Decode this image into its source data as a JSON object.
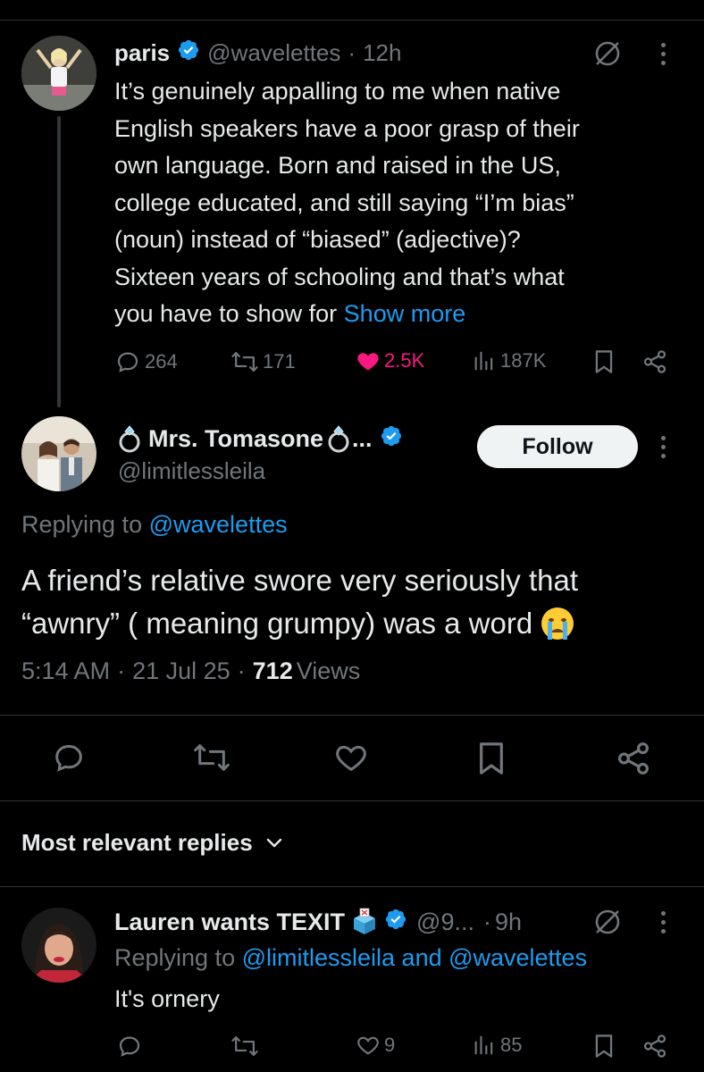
{
  "tweet1": {
    "name": "paris",
    "handle": "@wavelettes",
    "sep": "·",
    "time": "12h",
    "lines": [
      "It’s genuinely appalling to me when native",
      "English speakers have a poor grasp of their",
      "own language. Born and raised in the US,",
      "college educated, and still saying “I’m bias”",
      "(noun) instead of “biased” (adjective)?",
      "Sixteen years of schooling and that’s what",
      "you have to show for"
    ],
    "show_more": "Show more",
    "replies": "264",
    "retweets": "171",
    "likes": "2.5K",
    "views": "187K"
  },
  "main": {
    "name": "Mrs. Tomasone",
    "ring_icon": "ring-emoji",
    "ellipsis": "...",
    "handle": "@limitlessleila",
    "follow_label": "Follow",
    "replying_prefix": "Replying to",
    "replying_to": "@wavelettes",
    "text_line1": "A friend’s relative swore very seriously that",
    "text_line2": "“awnry” ( meaning grumpy) was a word",
    "time": "5:14 AM",
    "date": "21 Jul 25",
    "sep": "·",
    "views_count": "712",
    "views_label": "Views"
  },
  "replies_section": {
    "sort_label": "Most relevant replies"
  },
  "reply1": {
    "name": "Lauren wants TEXIT",
    "handle": "@9...",
    "sep": "·",
    "time": "9h",
    "replying_prefix": "Replying to",
    "replying_to": "@limitlessleila and @wavelettes",
    "text": "It's ornery",
    "likes": "9",
    "views": "85"
  },
  "colors": {
    "accent": "#1d9bf0",
    "like": "#f91880",
    "muted": "#71767b",
    "text": "#e7e9ea",
    "background": "#000000"
  }
}
